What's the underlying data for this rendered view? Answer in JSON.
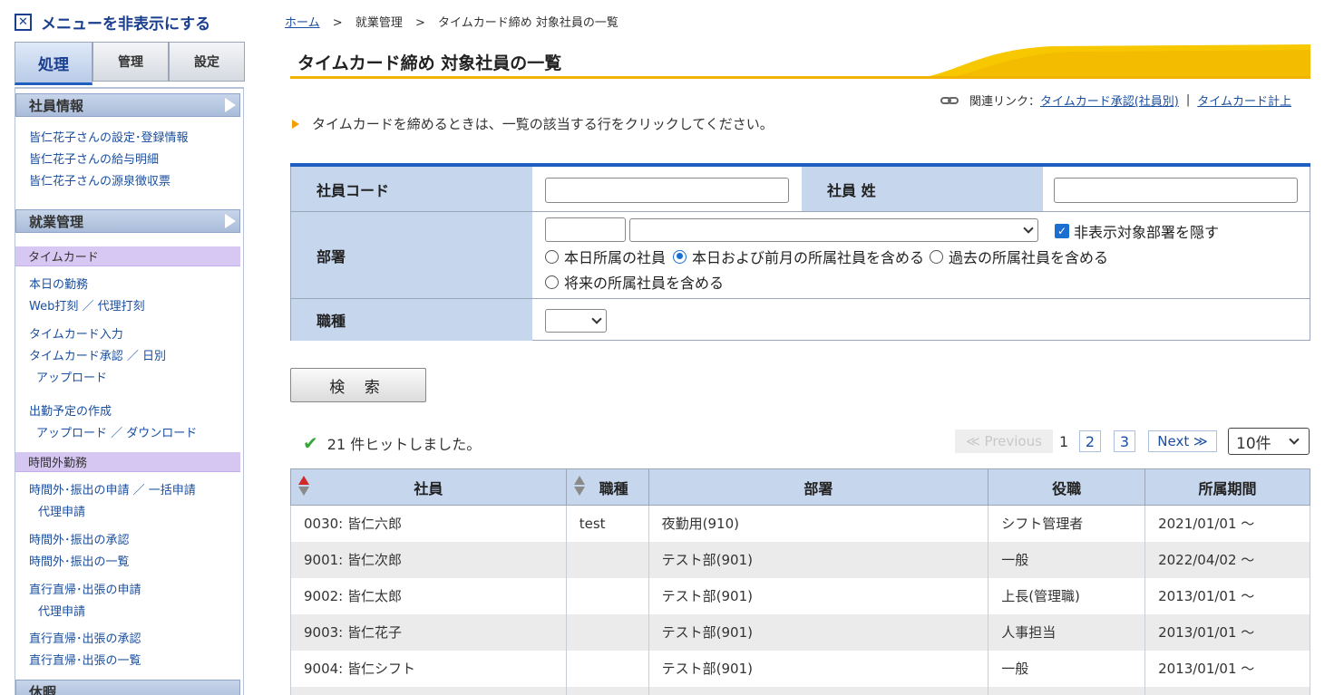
{
  "sidebar": {
    "hide_menu": "メニューを非表示にする",
    "tabs": [
      "処理",
      "管理",
      "設定"
    ],
    "sections": [
      {
        "title": "社員情報"
      },
      {
        "title": "就業管理"
      }
    ],
    "employee_links": [
      "皆仁花子さんの設定･登録情報",
      "皆仁花子さんの給与明細",
      "皆仁花子さんの源泉徴収票"
    ],
    "sub_timecard": "タイムカード",
    "timecard_links": [
      "本日の勤務",
      "Web打刻 ／ 代理打刻",
      "タイムカード入力",
      "タイムカード承認 ／ 日別",
      "アップロード",
      "出勤予定の作成",
      "アップロード ／ ダウンロード"
    ],
    "sub_overtime": "時間外勤務",
    "overtime_links": [
      "時間外･振出の申請 ／ 一括申請",
      "代理申請",
      "時間外･振出の承認",
      "時間外･振出の一覧",
      "直行直帰･出張の申請",
      "代理申請",
      "直行直帰･出張の承認",
      "直行直帰･出張の一覧"
    ],
    "sub_leave": "休暇"
  },
  "breadcrumb": {
    "home": "ホーム",
    "sep": ">",
    "level1": "就業管理",
    "current": "タイムカード締め 対象社員の一覧"
  },
  "page_title": "タイムカード締め 対象社員の一覧",
  "related": {
    "label": "関連リンク：",
    "link1": "タイムカード承認(社員別)",
    "bar": "|",
    "link2": "タイムカード計上"
  },
  "instruction": "タイムカードを締めるときは、一覧の該当する行をクリックしてください。",
  "form": {
    "employee_code_label": "社員コード",
    "employee_code_value": "",
    "surname_label": "社員 姓",
    "surname_value": "",
    "dept_label": "部署",
    "hide_checkbox_label": "非表示対象部署を隠す",
    "radio1": "本日所属の社員",
    "radio2": "本日および前月の所属社員を含める",
    "radio3": "過去の所属社員を含める",
    "radio4": "将来の所属社員を含める",
    "job_label": "職種"
  },
  "search_button": "検 索",
  "hits_text": "21 件ヒットしました。",
  "pager": {
    "prev": "≪ Previous",
    "current": "1",
    "page2": "2",
    "page3": "3",
    "next": "Next ≫",
    "per_page": "10件"
  },
  "table": {
    "headers": [
      "社員",
      "職種",
      "部署",
      "役職",
      "所属期間"
    ],
    "rows": [
      {
        "emp": "0030:  皆仁六郎",
        "job": "test",
        "dept": "夜勤用(910)",
        "title": "シフト管理者",
        "period": "2021/01/01 ～"
      },
      {
        "emp": "9001:  皆仁次郎",
        "job": "",
        "dept": "テスト部(901)",
        "title": "一般",
        "period": "2022/04/02 ～"
      },
      {
        "emp": "9002:  皆仁太郎",
        "job": "",
        "dept": "テスト部(901)",
        "title": "上長(管理職)",
        "period": "2013/01/01 ～"
      },
      {
        "emp": "9003:  皆仁花子",
        "job": "",
        "dept": "テスト部(901)",
        "title": "人事担当",
        "period": "2013/01/01 ～"
      },
      {
        "emp": "9004:  皆仁シフト",
        "job": "",
        "dept": "テスト部(901)",
        "title": "一般",
        "period": "2013/01/01 ～"
      }
    ]
  }
}
